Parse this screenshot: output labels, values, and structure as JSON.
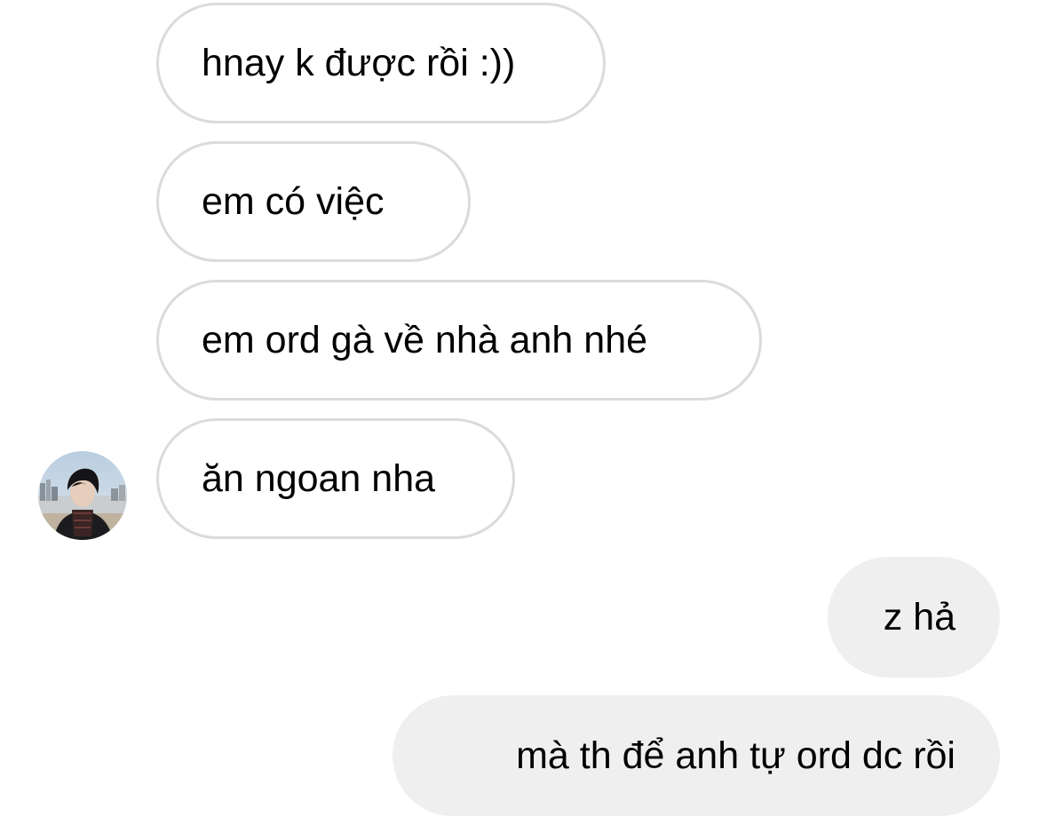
{
  "conversation": {
    "messages": [
      {
        "sender": "other",
        "text": "hnay k được rồi :))"
      },
      {
        "sender": "other",
        "text": "em có việc"
      },
      {
        "sender": "other",
        "text": "em ord gà về nhà anh nhé"
      },
      {
        "sender": "other",
        "text": "ăn ngoan nha"
      },
      {
        "sender": "me",
        "text": "z hả"
      },
      {
        "sender": "me",
        "text": "mà th để anh tự ord dc rồi"
      }
    ]
  },
  "colors": {
    "received_bubble_bg": "#ffffff",
    "received_bubble_border": "#dbdbdb",
    "sent_bubble_bg": "#efefef",
    "text": "#000000"
  },
  "icons": {
    "avatar": "contact-profile-photo"
  }
}
